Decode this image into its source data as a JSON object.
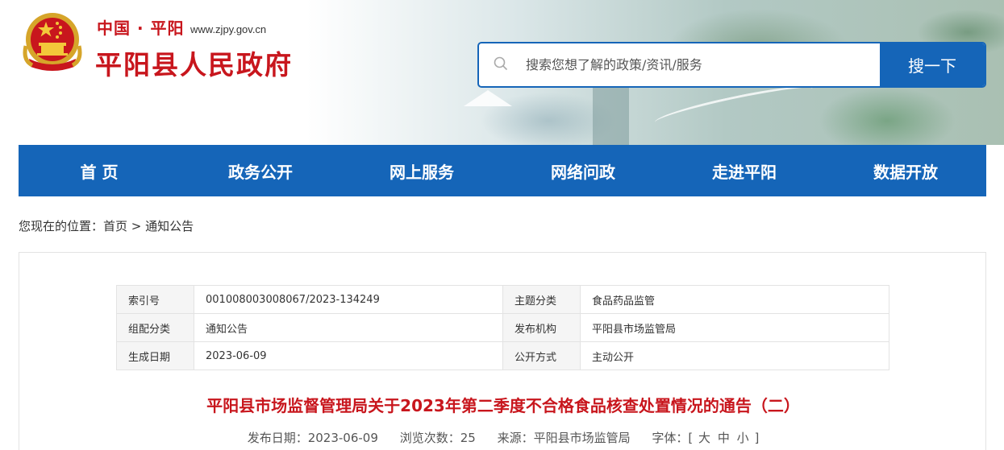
{
  "header": {
    "site_small": "中国 · 平阳",
    "site_url": "www.zjpy.gov.cn",
    "site_name": "平阳县人民政府",
    "emblem_icon": "national-emblem-icon",
    "search_placeholder": "搜索您想了解的政策/资讯/服务",
    "search_button": "搜一下"
  },
  "nav": {
    "items": [
      "首 页",
      "政务公开",
      "网上服务",
      "网络问政",
      "走进平阳",
      "数据开放"
    ]
  },
  "breadcrumb": {
    "prefix": "您现在的位置：",
    "home": "首页",
    "separator": " > ",
    "current": "通知公告"
  },
  "meta": {
    "rows": [
      {
        "label1": "索引号",
        "value1": "001008003008067/2023-134249",
        "label2": "主题分类",
        "value2": "食品药品监管"
      },
      {
        "label1": "组配分类",
        "value1": "通知公告",
        "label2": "发布机构",
        "value2": "平阳县市场监管局"
      },
      {
        "label1": "生成日期",
        "value1": "2023-06-09",
        "label2": "公开方式",
        "value2": "主动公开"
      }
    ]
  },
  "article": {
    "title": "平阳县市场监督管理局关于2023年第二季度不合格食品核查处置情况的通告（二）",
    "publish_label": "发布日期：",
    "publish_date": "2023-06-09",
    "views_label": "浏览次数：",
    "views": "25",
    "source_label": "来源：",
    "source": "平阳县市场监管局",
    "font_label": "字体：",
    "bracket_open": "[",
    "font_large": "大",
    "font_medium": "中",
    "font_small": "小",
    "bracket_close": "]"
  },
  "colors": {
    "brand_red": "#c8161d",
    "brand_blue": "#1565b8"
  }
}
